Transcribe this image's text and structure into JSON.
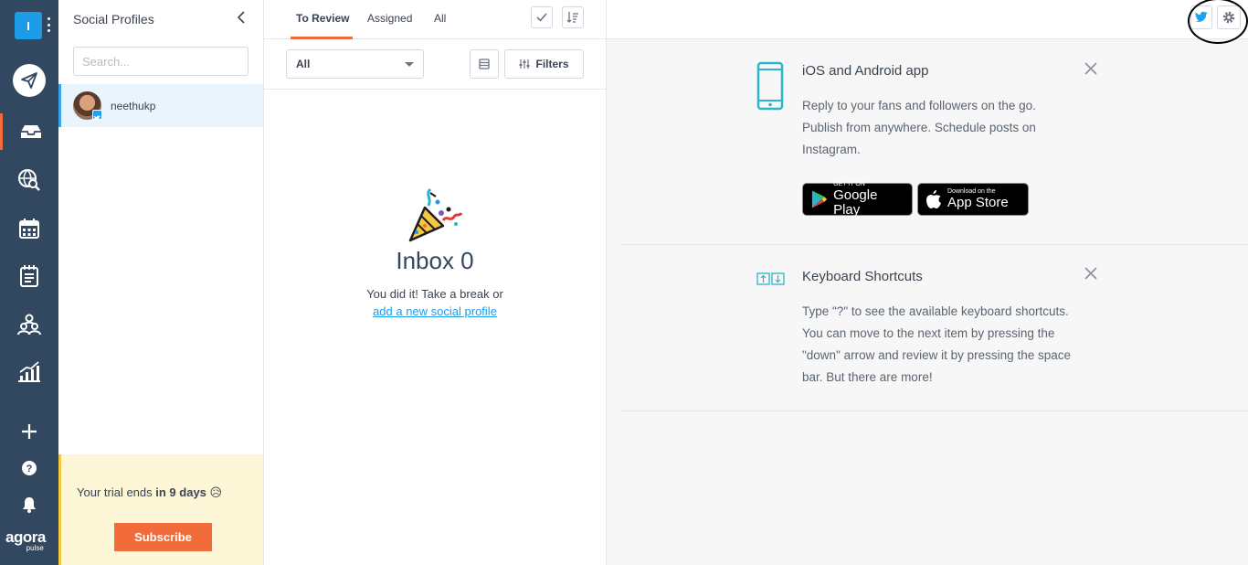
{
  "nav": {
    "logo_letter": "I",
    "brand_name": "agora",
    "brand_sub": "pulse",
    "items": [
      "compose-icon",
      "inbox-icon",
      "globe-search-icon",
      "calendar-icon",
      "notepad-icon",
      "team-icon",
      "reports-chart-icon",
      "plus-icon",
      "help-icon",
      "bell-icon"
    ]
  },
  "profiles": {
    "title": "Social Profiles",
    "search_placeholder": "Search...",
    "items": [
      {
        "name": "neethukp",
        "network": "twitter"
      }
    ],
    "trial_prefix": "Your trial ends",
    "trial_days": "in 9 days",
    "trial_emoji": "😥",
    "subscribe_label": "Subscribe"
  },
  "inbox": {
    "tabs": [
      "To Review",
      "Assigned",
      "All"
    ],
    "active_tab": "To Review",
    "select_value": "All",
    "filters_label": "Filters",
    "empty_title": "Inbox 0",
    "empty_message": "You did it! Take a break or",
    "empty_link": "add a new social profile"
  },
  "right": {
    "cards": [
      {
        "title": "iOS and Android app",
        "body": "Reply to your fans and followers on the go. Publish from anywhere. Schedule posts on Instagram.",
        "google_small": "GET IT ON",
        "google_big": "Google Play",
        "apple_small": "Download on the",
        "apple_big": "App Store"
      },
      {
        "title": "Keyboard Shortcuts",
        "body": "Type \"?\" to see the available keyboard shortcuts. You can move to the next item by pressing the \"down\" arrow and review it by pressing the space bar. But there are more!"
      }
    ]
  },
  "colors": {
    "nav_bg": "#324860",
    "accent_orange": "#f26b3a",
    "link_blue": "#1e9be6",
    "twitter_blue": "#1da1f2",
    "trial_bg": "#fdf6d7",
    "teal_icon": "#2bb5c9"
  }
}
